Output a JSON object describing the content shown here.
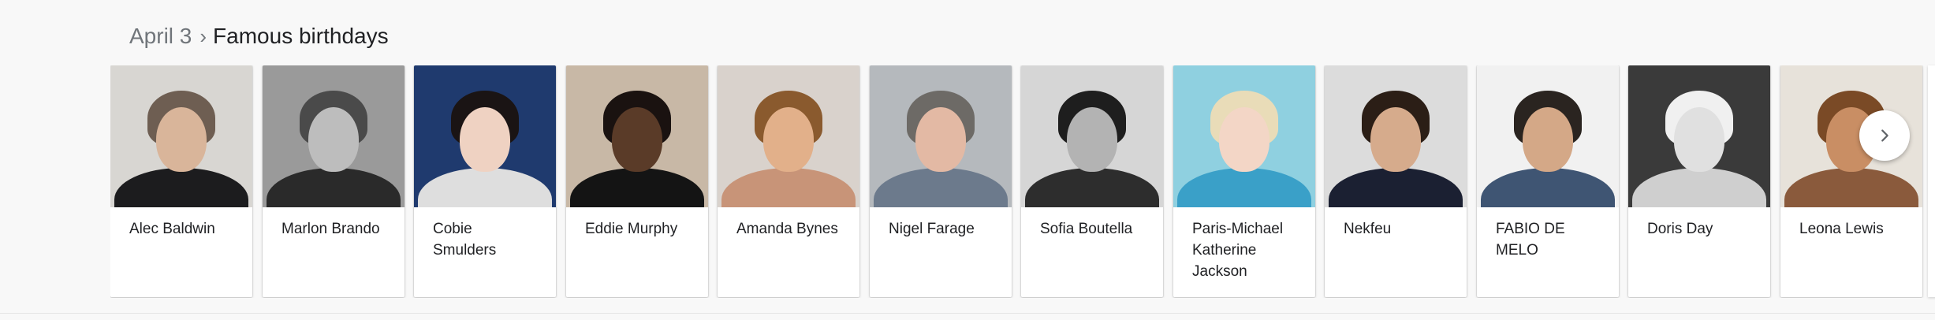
{
  "breadcrumb": {
    "parent": "April 3",
    "current": "Famous birthdays"
  },
  "people": [
    {
      "name": "Alec Baldwin",
      "bg": "#d8d6d2",
      "face": "#d9b59a",
      "hair": "#6e5e52",
      "torso": "#1c1c1e"
    },
    {
      "name": "Marlon Brando",
      "bg": "#9a9a9a",
      "face": "#bdbdbd",
      "hair": "#4a4a4a",
      "torso": "#2a2a2a"
    },
    {
      "name": "Cobie Smulders",
      "bg": "#1f3a6e",
      "face": "#efd2c2",
      "hair": "#1a1414",
      "torso": "#dedede"
    },
    {
      "name": "Eddie Murphy",
      "bg": "#c8b8a6",
      "face": "#5a3b28",
      "hair": "#1a1210",
      "torso": "#141414"
    },
    {
      "name": "Amanda Bynes",
      "bg": "#d9d2cc",
      "face": "#e2b08a",
      "hair": "#8a5a2e",
      "torso": "#c89478"
    },
    {
      "name": "Nigel Farage",
      "bg": "#b5b9bd",
      "face": "#e3b9a4",
      "hair": "#6d6a66",
      "torso": "#6c7a8c"
    },
    {
      "name": "Sofia Boutella",
      "bg": "#d6d6d6",
      "face": "#b3b3b3",
      "hair": "#1e1e1e",
      "torso": "#2d2d2d"
    },
    {
      "name": "Paris-Michael Katherine Jackson",
      "bg": "#8fd0e0",
      "face": "#f3d6c6",
      "hair": "#e9dcb8",
      "torso": "#3aa0c8"
    },
    {
      "name": "Nekfeu",
      "bg": "#dcdcdc",
      "face": "#d6ab8c",
      "hair": "#2b1e16",
      "torso": "#1b2032"
    },
    {
      "name": "FABIO DE MELO",
      "bg": "#f1f1f1",
      "face": "#d4a887",
      "hair": "#2a2420",
      "torso": "#3f5573"
    },
    {
      "name": "Doris Day",
      "bg": "#3a3a3a",
      "face": "#e0e0e0",
      "hair": "#f0f0f0",
      "torso": "#cfcfcf"
    },
    {
      "name": "Leona Lewis",
      "bg": "#e7e2da",
      "face": "#c98e64",
      "hair": "#7a4a26",
      "torso": "#8a5a3c"
    }
  ],
  "icons": {
    "next": "chevron-right-icon"
  }
}
